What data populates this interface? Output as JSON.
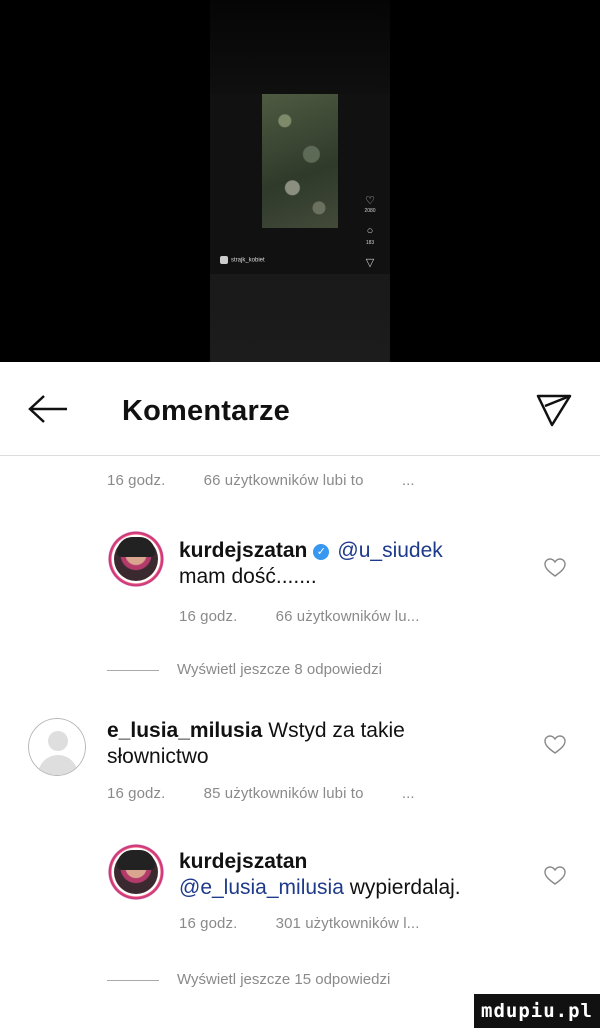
{
  "video": {
    "username": "strajk_kobiet",
    "like_count": "2080",
    "comment_count": "183"
  },
  "header": {
    "title": "Komentarze"
  },
  "top_meta": {
    "time": "16 godz.",
    "likes": "66 użytkowników lubi to",
    "more": "..."
  },
  "comments": [
    {
      "username": "kurdejszatan",
      "mention": "@u_siudek",
      "text": "mam dość.......",
      "time": "16 godz.",
      "likes": "66 użytkowników lu..."
    },
    {
      "username": "e_lusia_milusia",
      "text_line1": "Wstyd za takie",
      "text_line2": "słownictwo",
      "time": "16 godz.",
      "likes": "85 użytkowników lubi to",
      "more": "..."
    },
    {
      "username": "kurdejszatan",
      "mention": "@e_lusia_milusia",
      "text": "wypierdalaj.",
      "time": "16 godz.",
      "likes": "301 użytkowników l..."
    }
  ],
  "replies": [
    {
      "label": "Wyświetl jeszcze 8 odpowiedzi"
    },
    {
      "label": "Wyświetl jeszcze 15 odpowiedzi"
    }
  ],
  "watermark": "mdupiu.pl",
  "colors": {
    "mention": "#1e3a8a",
    "meta_text": "#8a8a8a",
    "verified": "#3897f0"
  }
}
